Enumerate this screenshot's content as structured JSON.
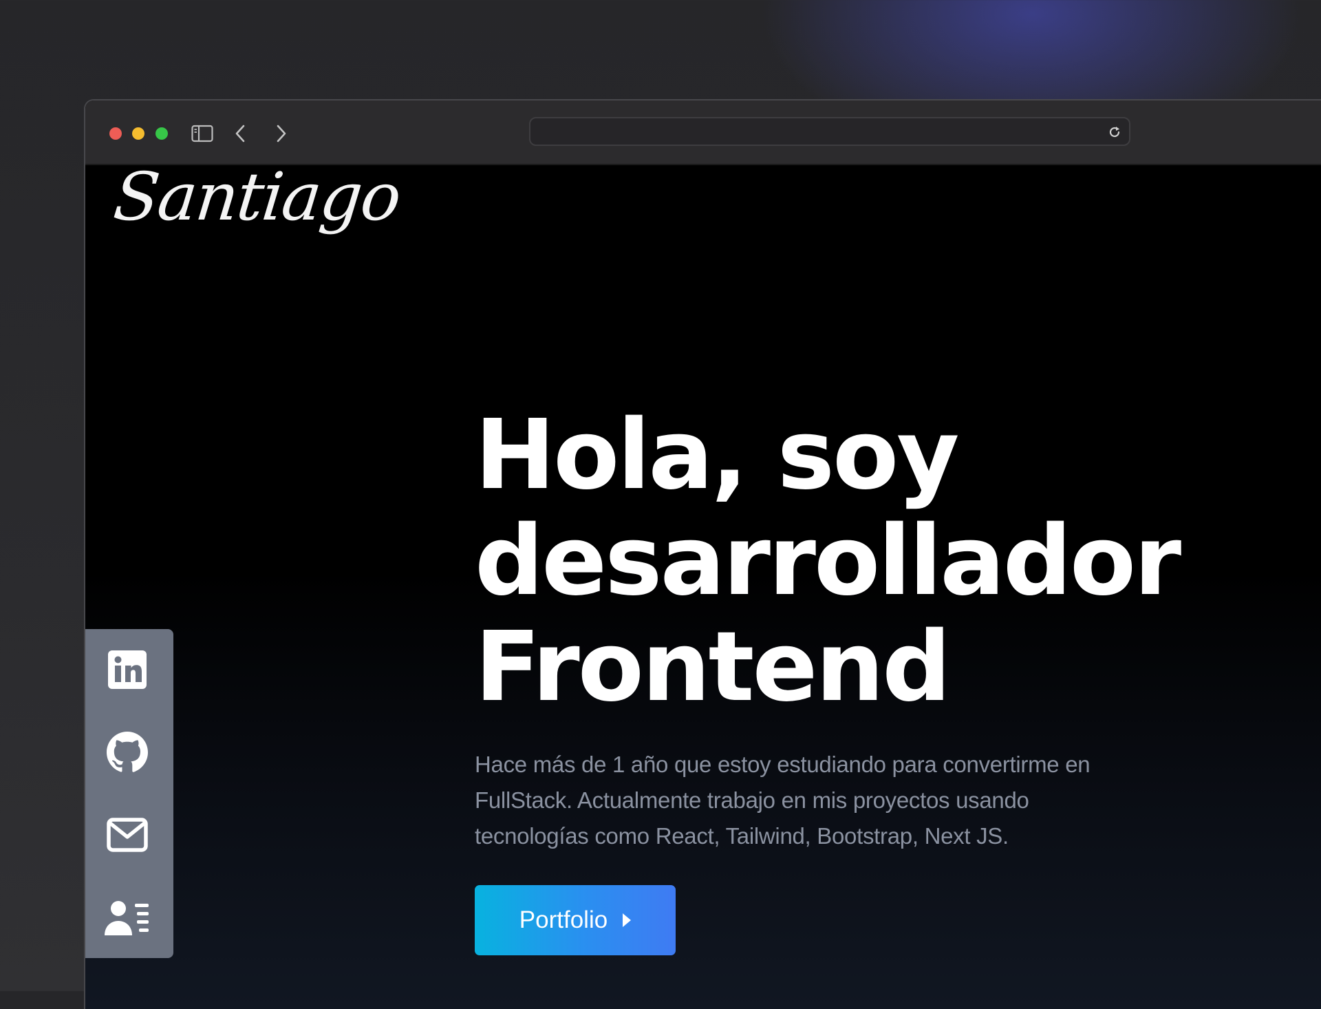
{
  "browser": {
    "window_controls": [
      "close",
      "minimize",
      "zoom"
    ],
    "toolbar_icons": [
      "sidebar-icon",
      "back-icon",
      "forward-icon",
      "reload-icon"
    ],
    "url": ""
  },
  "site": {
    "logo": "Santiago",
    "hero": {
      "title_lines": [
        "Hola, soy",
        "desarrollador",
        "Frontend"
      ],
      "description": "Hace más de 1 año que estoy estudiando para convertirme en FullStack. Actualmente trabajo en mis proyectos usando tecnologías como React, Tailwind, Bootstrap, Next JS."
    },
    "cta": {
      "label": "Portfolio",
      "icon": "caret-right-icon"
    },
    "social": [
      "linkedin-icon",
      "github-icon",
      "mail-icon",
      "resume-icon"
    ]
  },
  "colors": {
    "background": "#000000",
    "social_bar": "#6b7280",
    "button_gradient": [
      "#08b2df",
      "#3f7bf3"
    ],
    "description_text": "#8b92a1"
  }
}
